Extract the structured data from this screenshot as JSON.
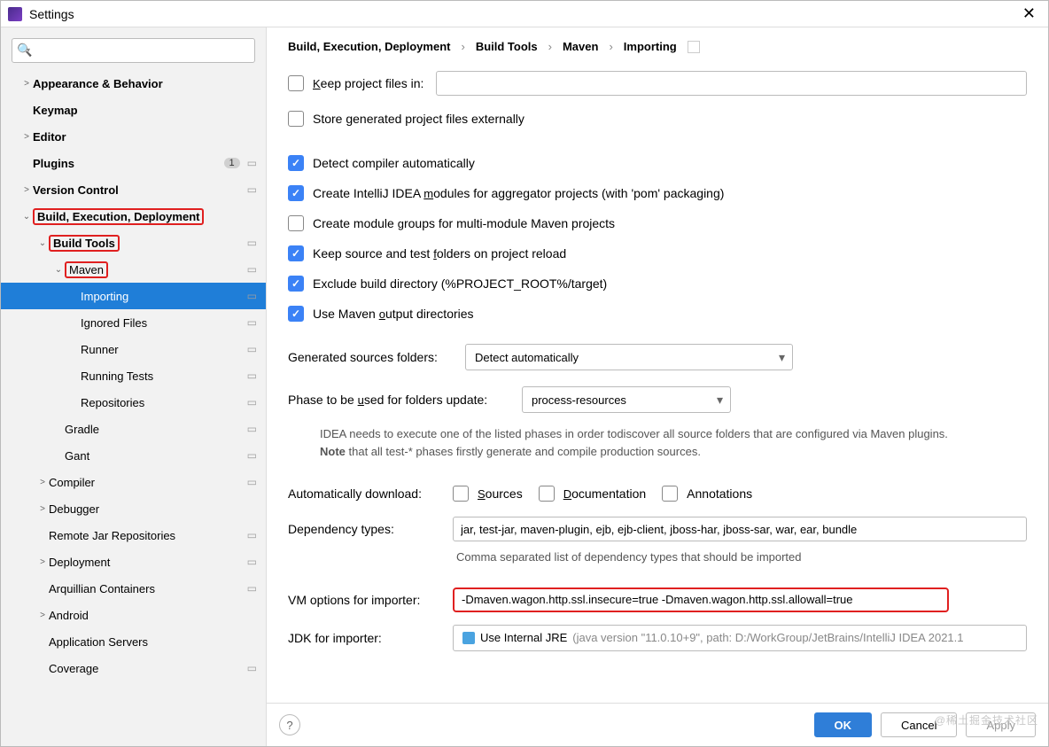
{
  "window": {
    "title": "Settings"
  },
  "search": {
    "placeholder": ""
  },
  "sidebar": {
    "items": [
      {
        "id": "appearance",
        "label": "Appearance & Behavior",
        "bold": true,
        "chev": ">",
        "ind": 0
      },
      {
        "id": "keymap",
        "label": "Keymap",
        "bold": true,
        "ind": 0
      },
      {
        "id": "editor",
        "label": "Editor",
        "bold": true,
        "chev": ">",
        "ind": 0
      },
      {
        "id": "plugins",
        "label": "Plugins",
        "bold": true,
        "ind": 0,
        "badge": "1",
        "dot": true
      },
      {
        "id": "vcs",
        "label": "Version Control",
        "bold": true,
        "chev": ">",
        "ind": 0,
        "dot": true
      },
      {
        "id": "bed",
        "label": "Build, Execution, Deployment",
        "bold": true,
        "chev": "⌄",
        "ind": 0,
        "red": true
      },
      {
        "id": "buildtools",
        "label": "Build Tools",
        "bold": true,
        "chev": "⌄",
        "ind": 1,
        "red": true,
        "dot": true
      },
      {
        "id": "maven",
        "label": "Maven",
        "chev": "⌄",
        "ind": 2,
        "red": true,
        "dot": true
      },
      {
        "id": "importing",
        "label": "Importing",
        "ind": 3,
        "selected": true,
        "dot": true
      },
      {
        "id": "ignored",
        "label": "Ignored Files",
        "ind": 3,
        "dot": true
      },
      {
        "id": "runner",
        "label": "Runner",
        "ind": 3,
        "dot": true
      },
      {
        "id": "runtests",
        "label": "Running Tests",
        "ind": 3,
        "dot": true
      },
      {
        "id": "repos",
        "label": "Repositories",
        "ind": 3,
        "dot": true
      },
      {
        "id": "gradle",
        "label": "Gradle",
        "ind": 2,
        "dot": true
      },
      {
        "id": "gant",
        "label": "Gant",
        "ind": 2,
        "dot": true
      },
      {
        "id": "compiler",
        "label": "Compiler",
        "chev": ">",
        "ind": 1,
        "dot": true
      },
      {
        "id": "debugger",
        "label": "Debugger",
        "chev": ">",
        "ind": 1
      },
      {
        "id": "remotejar",
        "label": "Remote Jar Repositories",
        "ind": 1,
        "dot": true
      },
      {
        "id": "deployment",
        "label": "Deployment",
        "chev": ">",
        "ind": 1,
        "dot": true
      },
      {
        "id": "arquillian",
        "label": "Arquillian Containers",
        "ind": 1,
        "dot": true
      },
      {
        "id": "android",
        "label": "Android",
        "chev": ">",
        "ind": 1
      },
      {
        "id": "appservers",
        "label": "Application Servers",
        "ind": 1
      },
      {
        "id": "coverage",
        "label": "Coverage",
        "ind": 1,
        "dot": true
      }
    ]
  },
  "breadcrumb": [
    "Build, Execution, Deployment",
    "Build Tools",
    "Maven",
    "Importing"
  ],
  "checks": {
    "keep_project_files": {
      "label": "Keep project files in:",
      "checked": false
    },
    "store_external": {
      "label": "Store generated project files externally",
      "checked": false
    },
    "detect_compiler": {
      "label": "Detect compiler automatically",
      "checked": true
    },
    "create_modules": {
      "label": "Create IntelliJ IDEA modules for aggregator projects (with 'pom' packaging)",
      "checked": true
    },
    "module_groups": {
      "label": "Create module groups for multi-module Maven projects",
      "checked": false
    },
    "keep_folders": {
      "label": "Keep source and test folders on project reload",
      "checked": true
    },
    "exclude_build": {
      "label": "Exclude build directory (%PROJECT_ROOT%/target)",
      "checked": true
    },
    "use_output": {
      "label": "Use Maven output directories",
      "checked": true
    }
  },
  "generated": {
    "label": "Generated sources folders:",
    "value": "Detect automatically"
  },
  "phase": {
    "label": "Phase to be used for folders update:",
    "value": "process-resources",
    "note1": "IDEA needs to execute one of the listed phases in order todiscover all source folders that are configured via Maven plugins.",
    "note2_prefix": "Note",
    "note2": " that all test-* phases firstly generate and compile production sources."
  },
  "auto_dl": {
    "label": "Automatically download:",
    "sources": "Sources",
    "docs": "Documentation",
    "ann": "Annotations"
  },
  "dep_types": {
    "label": "Dependency types:",
    "value": "jar, test-jar, maven-plugin, ejb, ejb-client, jboss-har, jboss-sar, war, ear, bundle",
    "hint": "Comma separated list of dependency types that should be imported"
  },
  "vm": {
    "label": "VM options for importer:",
    "value": "-Dmaven.wagon.http.ssl.insecure=true -Dmaven.wagon.http.ssl.allowall=true"
  },
  "jdk": {
    "label": "JDK for importer:",
    "value": "Use Internal JRE",
    "detail": "(java version \"11.0.10+9\", path: D:/WorkGroup/JetBrains/IntelliJ IDEA 2021.1"
  },
  "footer": {
    "ok": "OK",
    "cancel": "Cancel",
    "apply": "Apply"
  },
  "watermark": "@稀土掘金技术社区"
}
